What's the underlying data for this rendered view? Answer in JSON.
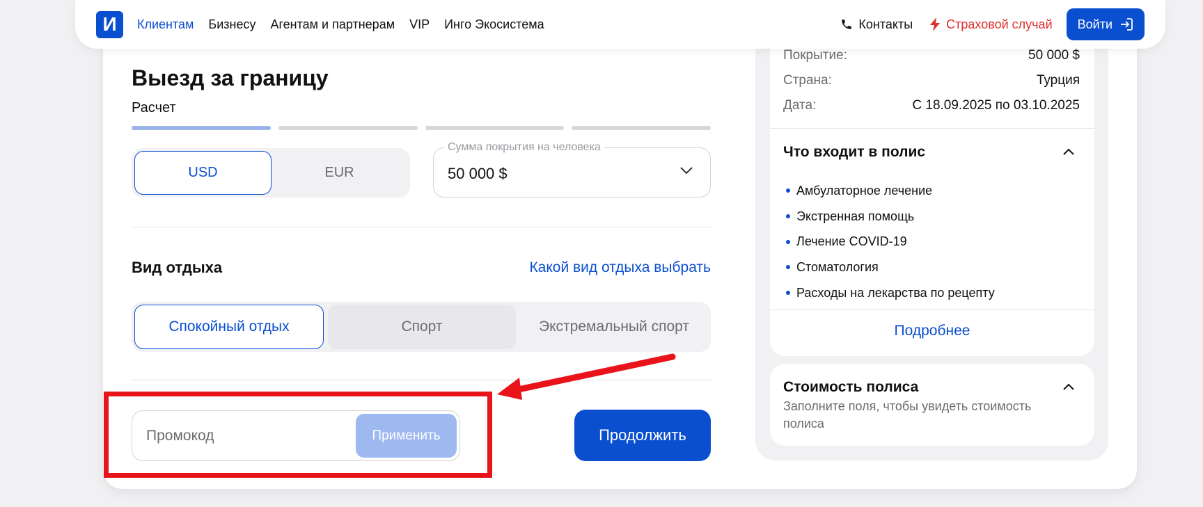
{
  "nav": {
    "logo": "И",
    "links": [
      "Клиентам",
      "Бизнесу",
      "Агентам и партнерам",
      "VIP",
      "Инго Экосистема"
    ],
    "contacts": "Контакты",
    "claim": "Страховой случай",
    "login": "Войти"
  },
  "form": {
    "title": "Выезд за границу",
    "step": "Расчет",
    "progress": {
      "total": 4,
      "completed": 1
    },
    "currency": {
      "options": [
        "USD",
        "EUR"
      ],
      "selected": "USD"
    },
    "coverage": {
      "label": "Сумма покрытия на человека",
      "value": "50 000 $"
    },
    "rest_type": {
      "title": "Вид отдыха",
      "help_link": "Какой вид отдыха выбрать",
      "options": [
        "Спокойный отдых",
        "Спорт",
        "Экстремальный спорт"
      ],
      "selected": "Спокойный отдых"
    },
    "promo": {
      "placeholder": "Промокод",
      "apply": "Применить"
    },
    "continue": "Продолжить"
  },
  "summary": {
    "rows": [
      {
        "key": "Покрытие:",
        "value": "50 000 $"
      },
      {
        "key": "Страна:",
        "value": "Турция"
      },
      {
        "key": "Дата:",
        "value": "С 18.09.2025 по 03.10.2025"
      }
    ],
    "included_title": "Что входит в полис",
    "included": [
      "Амбулаторное лечение",
      "Экстренная помощь",
      "Лечение COVID-19",
      "Стоматология",
      "Расходы на лекарства по рецепту"
    ],
    "more": "Подробнее",
    "price_title": "Стоимость полиса",
    "price_note": "Заполните поля, чтобы увидеть стоимость полиса"
  },
  "colors": {
    "accent": "#0b4fd1",
    "danger": "#e0302c",
    "annotation": "#e8141a"
  }
}
